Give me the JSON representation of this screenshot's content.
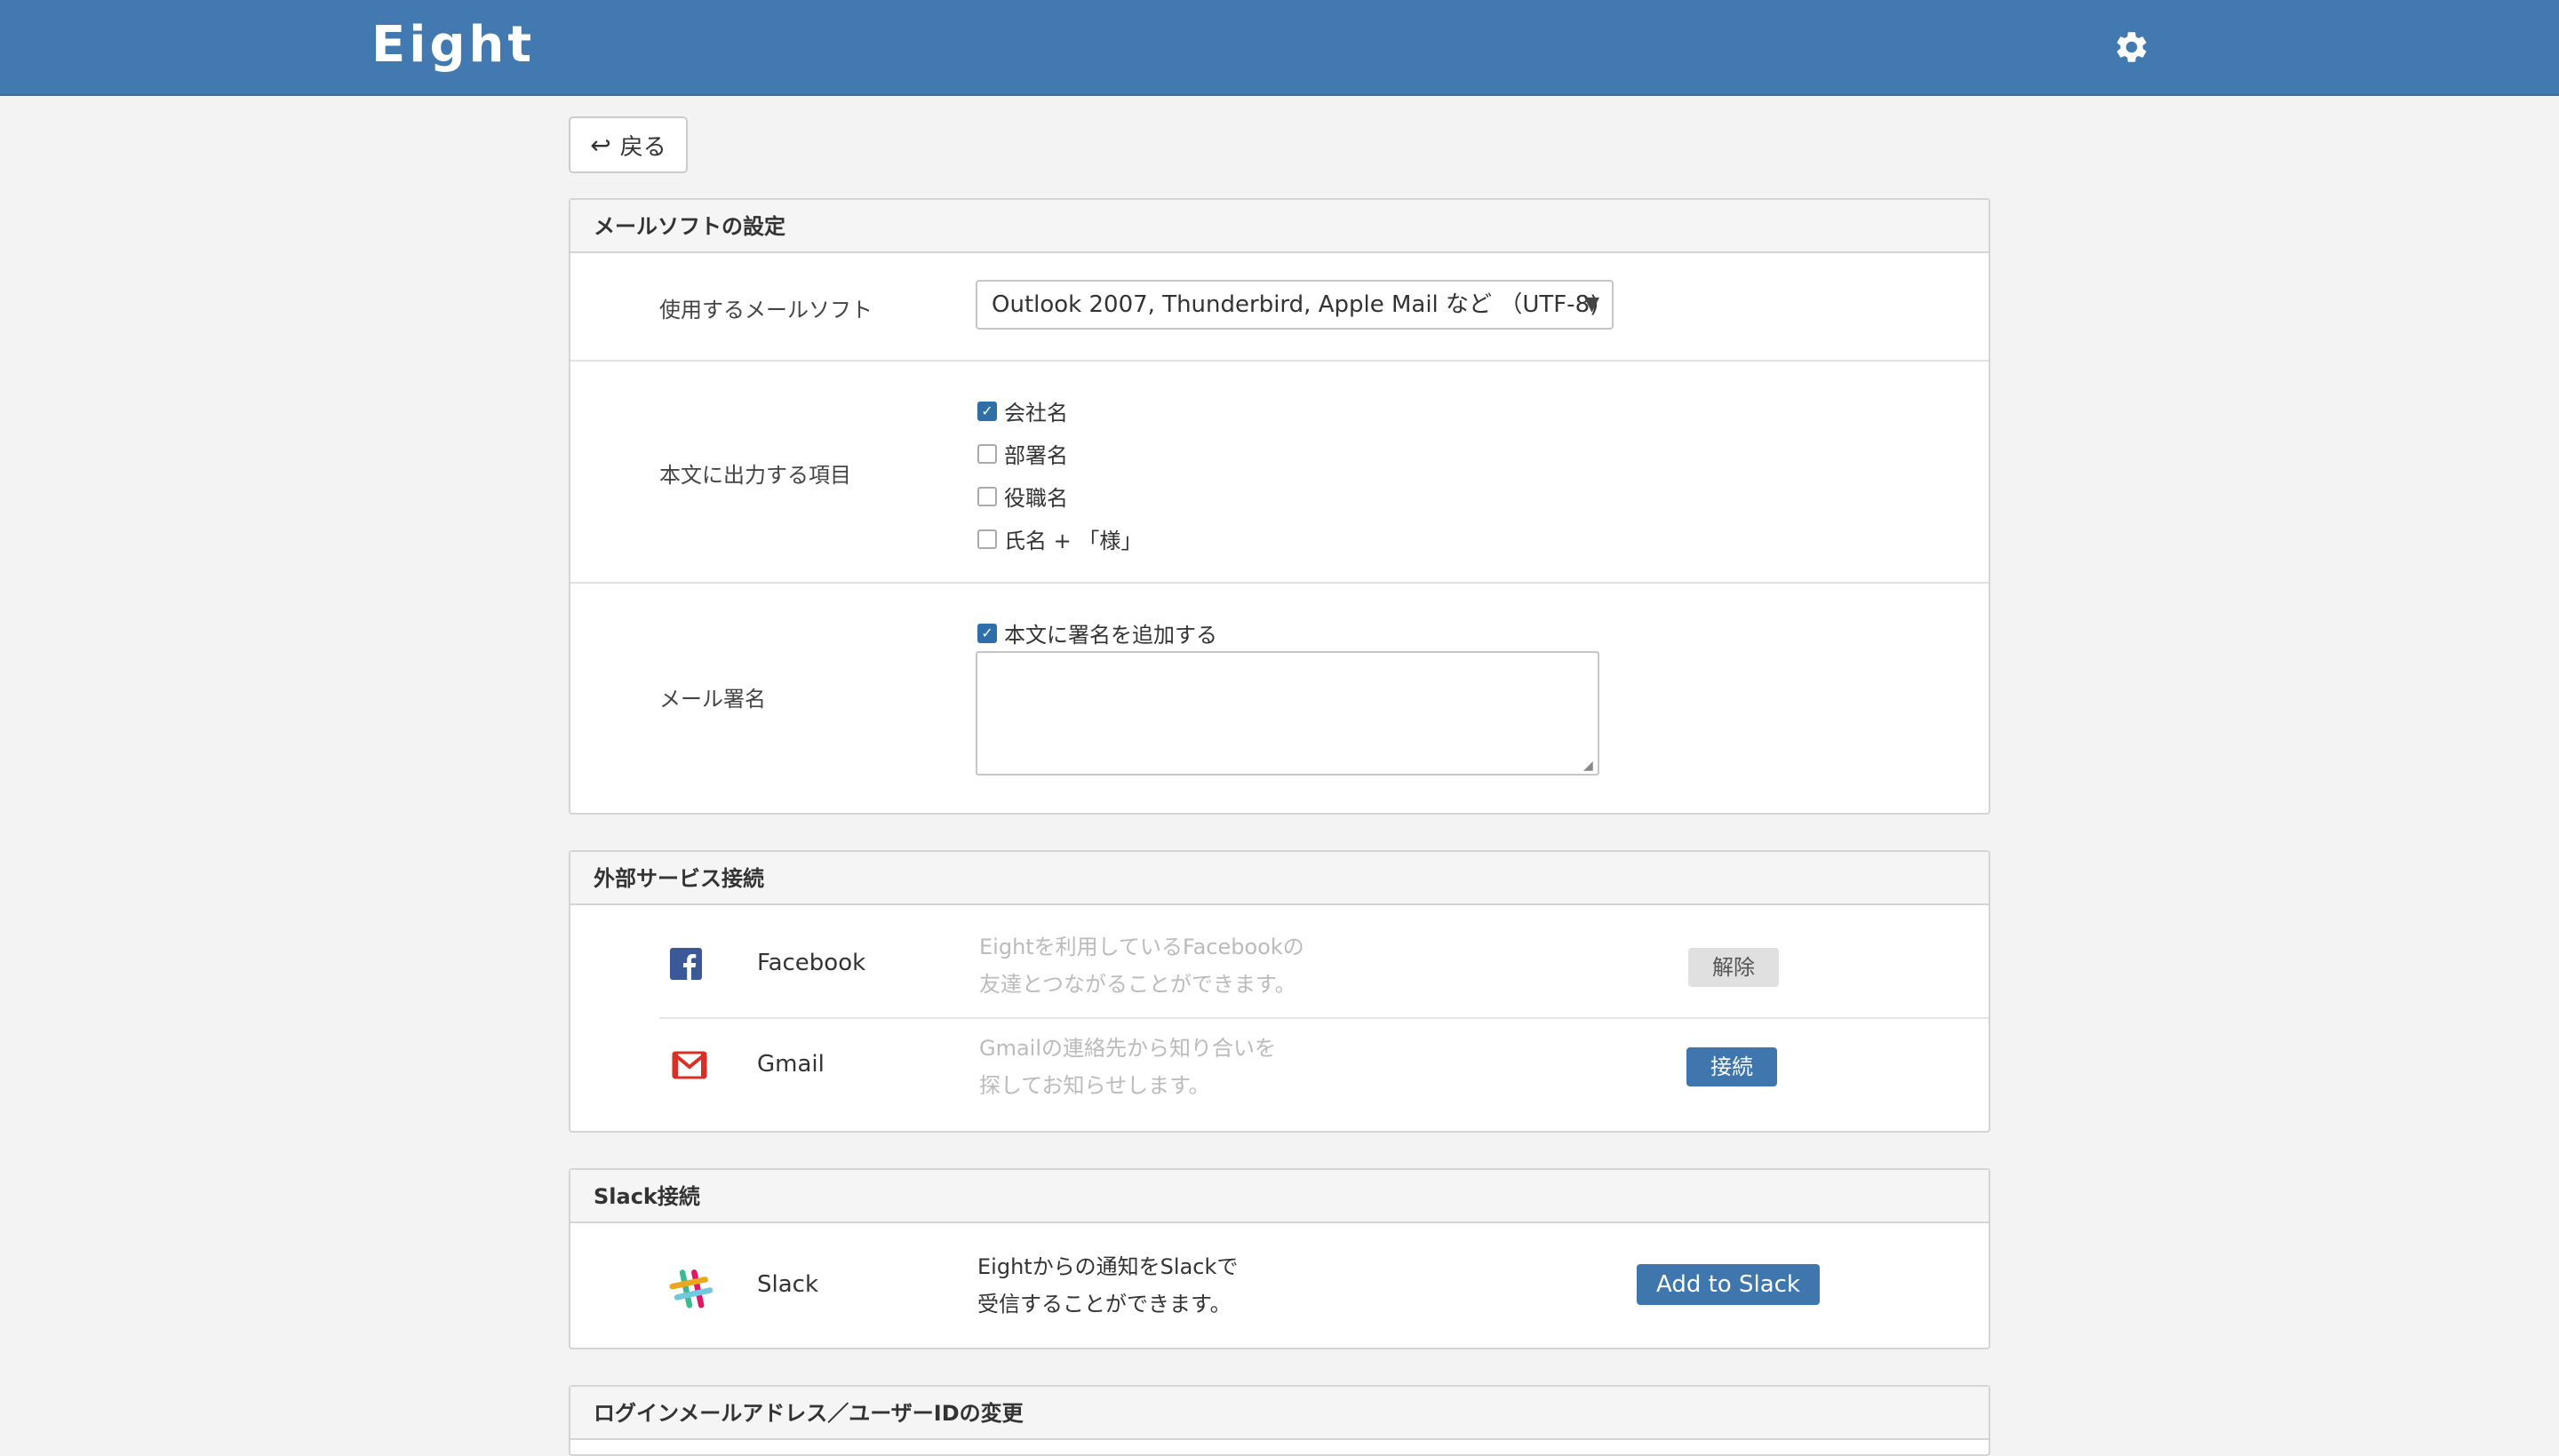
{
  "header": {
    "logo": "Eight",
    "settings_icon": "gear-icon"
  },
  "back_button": {
    "label": "戻る",
    "icon": "back-arrow-icon"
  },
  "mail_settings": {
    "title": "メールソフトの設定",
    "software_label": "使用するメールソフト",
    "software_value": "Outlook 2007, Thunderbird, Apple Mail など （UTF-8)",
    "items_label": "本文に出力する項目",
    "items": [
      {
        "label": "会社名",
        "checked": true
      },
      {
        "label": "部署名",
        "checked": false
      },
      {
        "label": "役職名",
        "checked": false
      },
      {
        "label": "氏名 + 「様」",
        "checked": false
      }
    ],
    "signature_label": "メール署名",
    "signature_checkbox": "本文に署名を追加する",
    "signature_checked": true,
    "signature_text": ""
  },
  "external": {
    "title": "外部サービス接続",
    "services": [
      {
        "name": "Facebook",
        "desc1": "Eightを利用しているFacebookの",
        "desc2": "友達とつながることができます。",
        "button": "解除",
        "icon": "facebook-icon"
      },
      {
        "name": "Gmail",
        "desc1": "Gmailの連絡先から知り合いを",
        "desc2": "探してお知らせします。",
        "button": "接続",
        "icon": "gmail-icon"
      }
    ]
  },
  "slack": {
    "title": "Slack接続",
    "name": "Slack",
    "desc1": "Eightからの通知をSlackで",
    "desc2": "受信することができます。",
    "button": "Add to Slack",
    "icon": "slack-icon"
  },
  "login": {
    "title": "ログインメールアドレス／ユーザーIDの変更"
  },
  "colors": {
    "header_bg": "#4279b0",
    "accent_button": "#3e76ad",
    "gray_button": "#e0e0e0"
  }
}
